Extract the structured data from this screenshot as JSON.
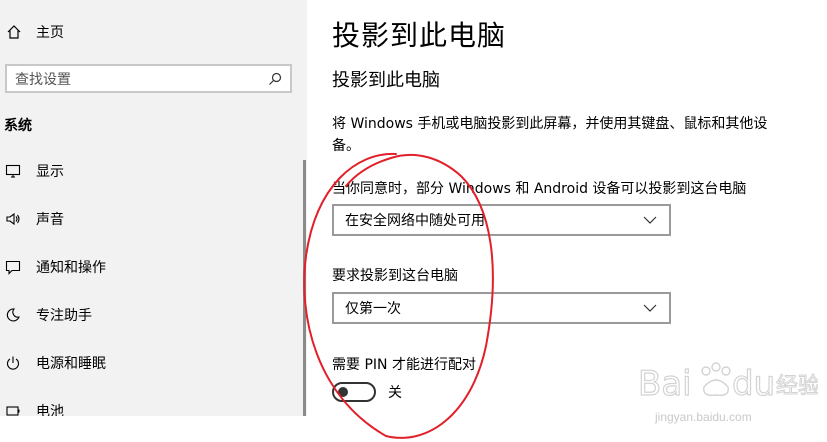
{
  "sidebar": {
    "home_label": "主页",
    "search_placeholder": "查找设置",
    "section_title": "系统",
    "items": [
      {
        "label": "显示",
        "icon": "monitor-icon"
      },
      {
        "label": "声音",
        "icon": "speaker-icon"
      },
      {
        "label": "通知和操作",
        "icon": "notification-icon"
      },
      {
        "label": "专注助手",
        "icon": "moon-icon"
      },
      {
        "label": "电源和睡眠",
        "icon": "power-icon"
      },
      {
        "label": "电池",
        "icon": "battery-icon"
      }
    ]
  },
  "main": {
    "page_title": "投影到此电脑",
    "sub_title": "投影到此电脑",
    "description": "将 Windows 手机或电脑投影到此屏幕，并使用其键盘、鼠标和其他设备。",
    "setting1_label": "当你同意时，部分 Windows 和 Android 设备可以投影到这台电脑",
    "setting1_value": "在安全网络中随处可用",
    "setting2_label": "要求投影到这台电脑",
    "setting2_value": "仅第一次",
    "setting3_label": "需要 PIN 才能进行配对",
    "setting3_state": "关"
  },
  "watermark": {
    "url": "jingyan.baidu.com"
  },
  "colors": {
    "sidebar_bg": "#f2f2f2",
    "annotation_red": "#e2202a",
    "border": "#9a9a9a"
  }
}
